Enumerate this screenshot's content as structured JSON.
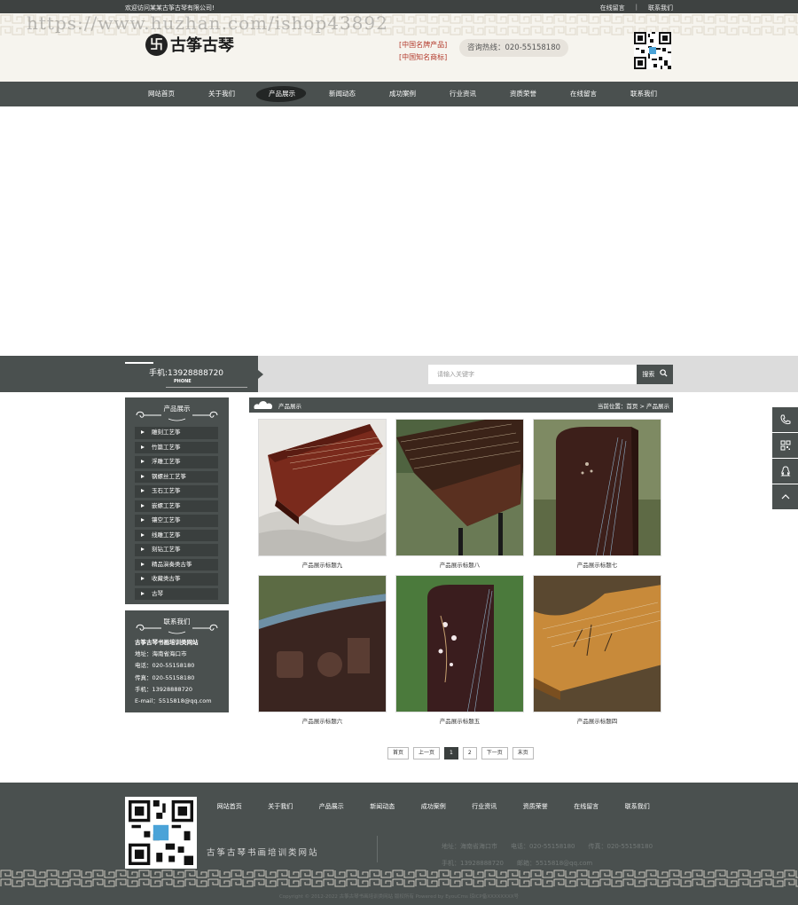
{
  "topbar": {
    "welcome": "欢迎访问某某古筝古琴有限公司!",
    "links": [
      "在线留言",
      "联系我们"
    ],
    "sep": "|"
  },
  "watermark": "https://www.huzhan.com/ishop43892",
  "header": {
    "logo_mark": "卐",
    "logo_text": "古筝古琴",
    "honors": [
      "[中国名牌产品]",
      "[中国知名商标]"
    ],
    "hotline": "咨询热线：020-55158180"
  },
  "nav": {
    "items": [
      "网站首页",
      "关于我们",
      "产品展示",
      "新闻动态",
      "成功案例",
      "行业资讯",
      "资质荣誉",
      "在线留言",
      "联系我们"
    ],
    "active_index": 2
  },
  "searchbar": {
    "phone": "手机:13928888720",
    "phone_sub": "PHONE",
    "placeholder": "请输入关键字",
    "button": "搜索"
  },
  "sidebar": {
    "products_title": "产品展示",
    "categories": [
      "雕刻工艺筝",
      "竹篇工艺筝",
      "浮雕工艺筝",
      "钢螺丝工艺筝",
      "玉石工艺筝",
      "嵌螺工艺筝",
      "镶空工艺筝",
      "线雕工艺筝",
      "刻钻工艺筝",
      "精品演奏类古筝",
      "收藏类古筝",
      "古琴"
    ],
    "contact_title": "联系我们",
    "contact": {
      "name": "古筝古琴书画培训类网站",
      "address": "地址：海南省海口市",
      "tel": "电话：020-55158180",
      "fax": "传真：020-55158180",
      "mobile": "手机：13928888720",
      "email": "E-mail：5515818@qq.com"
    }
  },
  "main": {
    "section_title": "产品展示",
    "breadcrumb": "当前位置：首页 > 产品展示",
    "products": [
      {
        "caption": "产品展示标题九",
        "palette": "warm-red"
      },
      {
        "caption": "产品展示标题八",
        "palette": "dark-wood"
      },
      {
        "caption": "产品展示标题七",
        "palette": "carved-dark"
      },
      {
        "caption": "产品展示标题六",
        "palette": "relief"
      },
      {
        "caption": "产品展示标题五",
        "palette": "inlay"
      },
      {
        "caption": "产品展示标题四",
        "palette": "golden"
      }
    ],
    "pager": [
      "首页",
      "上一页",
      "1",
      "2",
      "下一页",
      "末页"
    ],
    "pager_current": "1"
  },
  "footer": {
    "nav": [
      "网站首页",
      "关于我们",
      "产品展示",
      "新闻动态",
      "成功案例",
      "行业资讯",
      "资质荣誉",
      "在线留言",
      "联系我们"
    ],
    "slogan": "古筝古琴书画培训类网站",
    "info_row1": [
      "地址：海南省海口市",
      "电话：020-55158180",
      "传真：020-55158180"
    ],
    "info_row2": [
      "手机：13928888720",
      "邮箱：5515818@qq.com"
    ],
    "copyright": "Copyright © 2012-2022 古筝古琴书画培训类网站 版权所有 Powered by EyouCms 琼ICP备XXXXXXXX号"
  },
  "colors": {
    "dark_slate": "#4a504f",
    "topbar": "#3e4241",
    "cream": "#f6f4ee",
    "red_honor": "#b33a2c"
  }
}
